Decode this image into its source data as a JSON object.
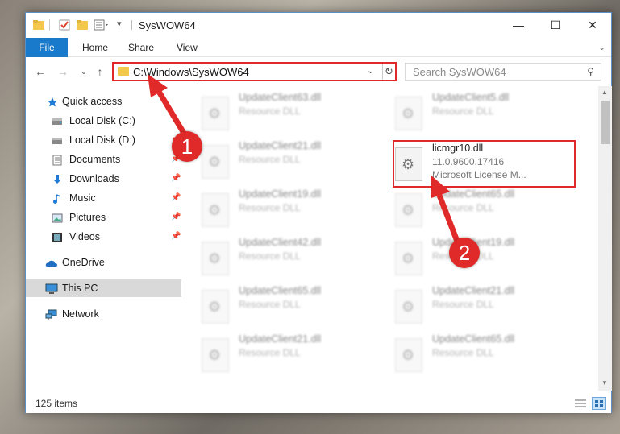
{
  "window": {
    "title": "SysWOW64",
    "controls": {
      "minimize": "—",
      "maximize": "☐",
      "close": "✕"
    }
  },
  "ribbon": {
    "tabs": [
      "File",
      "Home",
      "Share",
      "View"
    ]
  },
  "nav": {
    "address": "C:\\Windows\\SysWOW64",
    "search_placeholder": "Search SysWOW64"
  },
  "sidebar": {
    "items": [
      {
        "label": "Quick access",
        "icon": "star-icon",
        "pinned": false
      },
      {
        "label": "Local Disk (C:)",
        "icon": "drive-icon",
        "pinned": false
      },
      {
        "label": "Local Disk (D:)",
        "icon": "drive-icon",
        "pinned": true
      },
      {
        "label": "Documents",
        "icon": "documents-icon",
        "pinned": true
      },
      {
        "label": "Downloads",
        "icon": "downloads-icon",
        "pinned": true
      },
      {
        "label": "Music",
        "icon": "music-icon",
        "pinned": true
      },
      {
        "label": "Pictures",
        "icon": "pictures-icon",
        "pinned": true
      },
      {
        "label": "Videos",
        "icon": "videos-icon",
        "pinned": true
      },
      {
        "label": "OneDrive",
        "icon": "cloud-icon",
        "pinned": false
      },
      {
        "label": "This PC",
        "icon": "computer-icon",
        "pinned": false,
        "selected": true
      },
      {
        "label": "Network",
        "icon": "network-icon",
        "pinned": false
      }
    ]
  },
  "files": {
    "left_column": [
      {
        "name": "UpdateClient63.dll",
        "desc": "Resource DLL"
      },
      {
        "name": "UpdateClient21.dll",
        "desc": "Resource DLL"
      },
      {
        "name": "UpdateClient19.dll",
        "desc": "Resource DLL"
      },
      {
        "name": "UpdateClient42.dll",
        "desc": "Resource DLL"
      },
      {
        "name": "UpdateClient65.dll",
        "desc": "Resource DLL"
      },
      {
        "name": "UpdateClient21.dll",
        "desc": "Resource DLL"
      }
    ],
    "right_column": [
      {
        "name": "UpdateClient5.dll",
        "desc": "Resource DLL"
      },
      {
        "name": "licmgr10.dll",
        "desc": "11.0.9600.17416",
        "desc2": "Microsoft License M..."
      },
      {
        "name": "UpdateClient65.dll",
        "desc": "Resource DLL"
      },
      {
        "name": "UpdateClient19.dll",
        "desc": "Resource DLL"
      },
      {
        "name": "UpdateClient21.dll",
        "desc": "Resource DLL"
      },
      {
        "name": "UpdateClient65.dll",
        "desc": "Resource DLL"
      }
    ]
  },
  "status": {
    "item_count": "125 items"
  },
  "annotations": {
    "step1": "1",
    "step2": "2"
  },
  "colors": {
    "accent": "#1979ca",
    "highlight": "#e02a2a"
  }
}
